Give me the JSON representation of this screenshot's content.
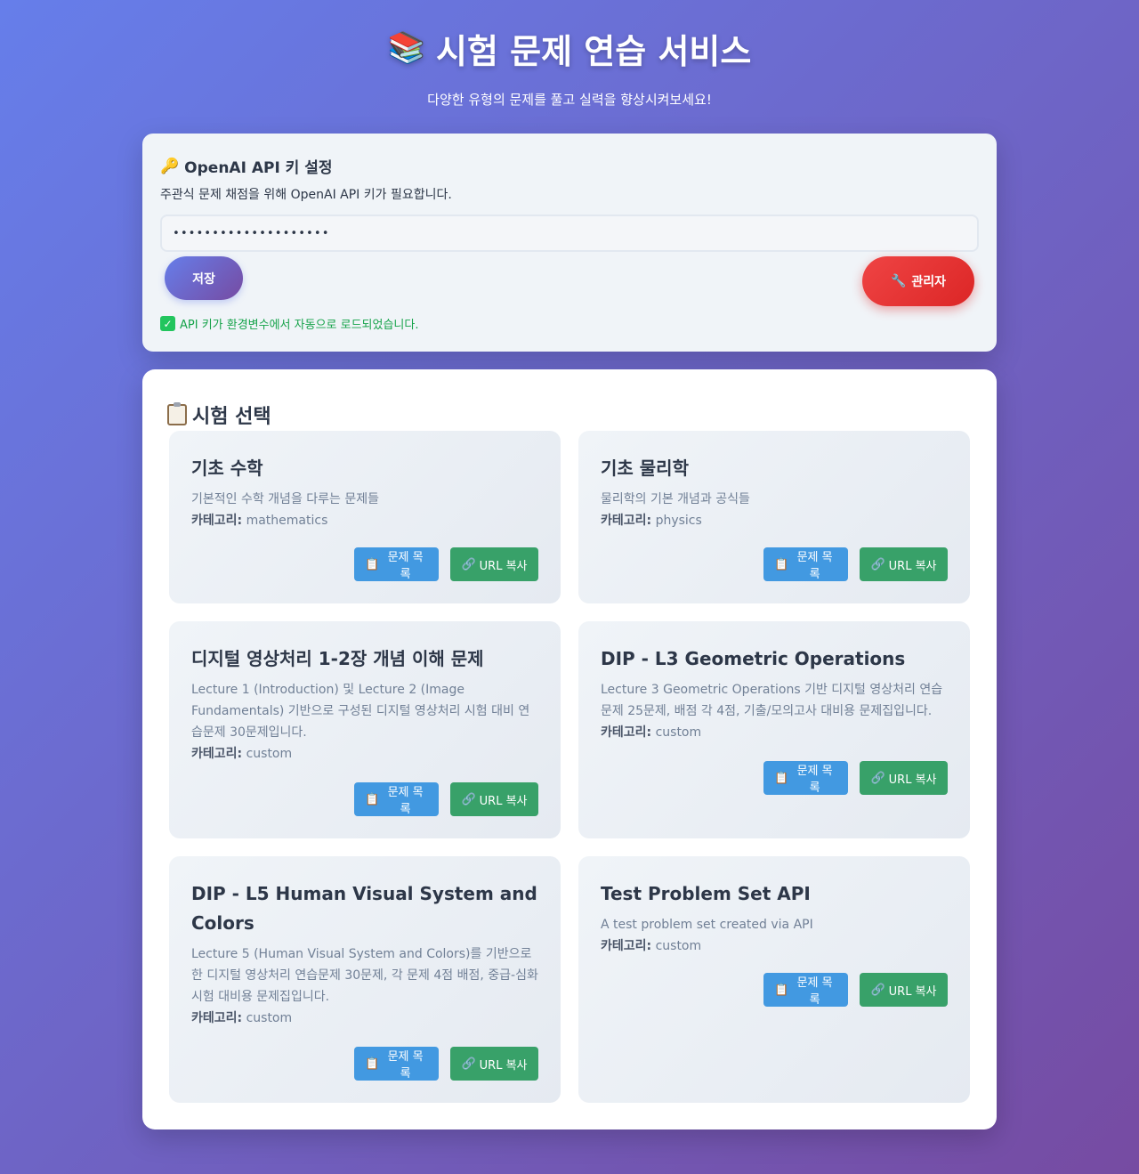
{
  "header": {
    "icon": "books-icon",
    "title": "시험 문제 연습 서비스",
    "subtitle": "다양한 유형의 문제를 풀고 실력을 향상시켜보세요!"
  },
  "api_panel": {
    "title": "OpenAI API 키 설정",
    "description": "주관식 문제 채점을 위해 OpenAI API 키가 필요합니다.",
    "input_value": "••••••••••••••••••••",
    "save_label": "저장",
    "admin_label": "관리자",
    "status": "API 키가 환경변수에서 자동으로 로드되었습니다."
  },
  "exams": {
    "title": "시험 선택",
    "list_label": "문제 목록",
    "url_label": "URL 복사",
    "category_label": "카테고리:",
    "items": [
      {
        "title": "기초 수학",
        "description": "기본적인 수학 개념을 다루는 문제들",
        "category": "mathematics"
      },
      {
        "title": "기초 물리학",
        "description": "물리학의 기본 개념과 공식들",
        "category": "physics"
      },
      {
        "title": "디지털 영상처리 1-2장 개념 이해 문제",
        "description": "Lecture 1 (Introduction) 및 Lecture 2 (Image Fundamentals) 기반으로 구성된 디지털 영상처리 시험 대비 연습문제 30문제입니다.",
        "category": "custom"
      },
      {
        "title": "DIP - L3 Geometric Operations",
        "description": "Lecture 3 Geometric Operations 기반 디지털 영상처리 연습문제 25문제, 배점 각 4점, 기출/모의고사 대비용 문제집입니다.",
        "category": "custom"
      },
      {
        "title": "DIP - L5 Human Visual System and Colors",
        "description": "Lecture 5 (Human Visual System and Colors)를 기반으로 한 디지털 영상처리 연습문제 30문제, 각 문제 4점 배점, 중급-심화 시험 대비용 문제집입니다.",
        "category": "custom"
      },
      {
        "title": "Test Problem Set API",
        "description": "A test problem set created via API",
        "category": "custom"
      }
    ]
  }
}
